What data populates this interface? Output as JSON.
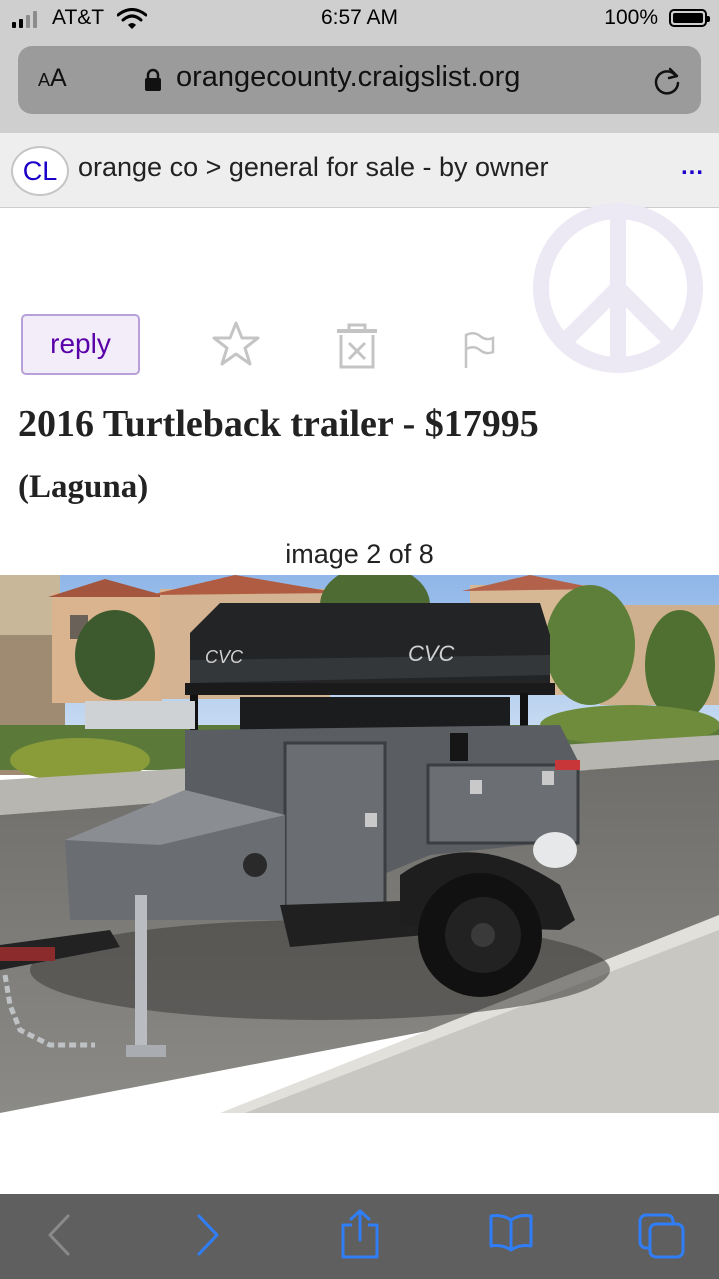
{
  "status_bar": {
    "carrier": "AT&T",
    "time": "6:57 AM",
    "battery": "100%"
  },
  "safari": {
    "text_size_small": "A",
    "text_size_big": "A",
    "url": "orangecounty.craigslist.org"
  },
  "header": {
    "logo": "CL",
    "breadcrumb": "orange co > general for sale - by owner",
    "menu": "..."
  },
  "post": {
    "reply_label": "reply",
    "title": "2016 Turtleback trailer - $17995",
    "location": "(Laguna)",
    "image_counter": "image 2 of 8"
  },
  "photo": {
    "tent_brand": "CVC"
  },
  "colors": {
    "link_blue": "#1a00c8",
    "reply_purple": "#5a00a8",
    "toolbar_blue": "#2f7ef7"
  }
}
